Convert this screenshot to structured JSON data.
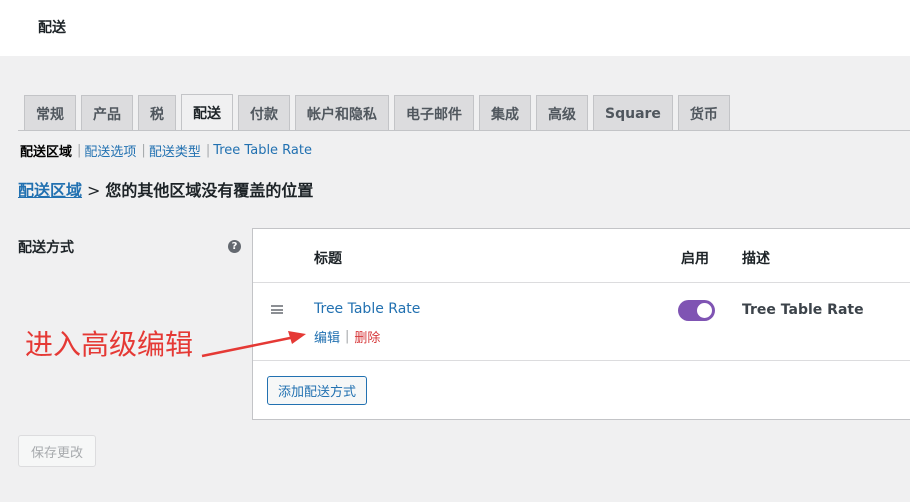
{
  "topbar": {
    "title": "配送"
  },
  "tabs": [
    {
      "label": "常规",
      "active": false
    },
    {
      "label": "产品",
      "active": false
    },
    {
      "label": "税",
      "active": false
    },
    {
      "label": "配送",
      "active": true
    },
    {
      "label": "付款",
      "active": false
    },
    {
      "label": "帐户和隐私",
      "active": false
    },
    {
      "label": "电子邮件",
      "active": false
    },
    {
      "label": "集成",
      "active": false
    },
    {
      "label": "高级",
      "active": false
    },
    {
      "label": "Square",
      "active": false
    },
    {
      "label": "货币",
      "active": false
    }
  ],
  "subnav": {
    "current": "配送区域",
    "links": [
      "配送选项",
      "配送类型",
      "Tree Table Rate"
    ]
  },
  "heading": {
    "link": "配送区域",
    "arrow": ">",
    "text": "您的其他区域没有覆盖的位置"
  },
  "form": {
    "label": "配送方式",
    "help_glyph": "?"
  },
  "table": {
    "columns": {
      "title": "标题",
      "enabled": "启用",
      "description": "描述"
    },
    "rows": [
      {
        "title": "Tree Table Rate",
        "edit": "编辑",
        "delete": "删除",
        "enabled": true,
        "description": "Tree Table Rate"
      }
    ],
    "add_button": "添加配送方式"
  },
  "save_button": "保存更改",
  "annotation": {
    "text": "进入高级编辑",
    "color": "#e53935"
  },
  "colors": {
    "accent": "#2271b1",
    "toggle": "#7f54b3",
    "danger": "#d63638"
  }
}
